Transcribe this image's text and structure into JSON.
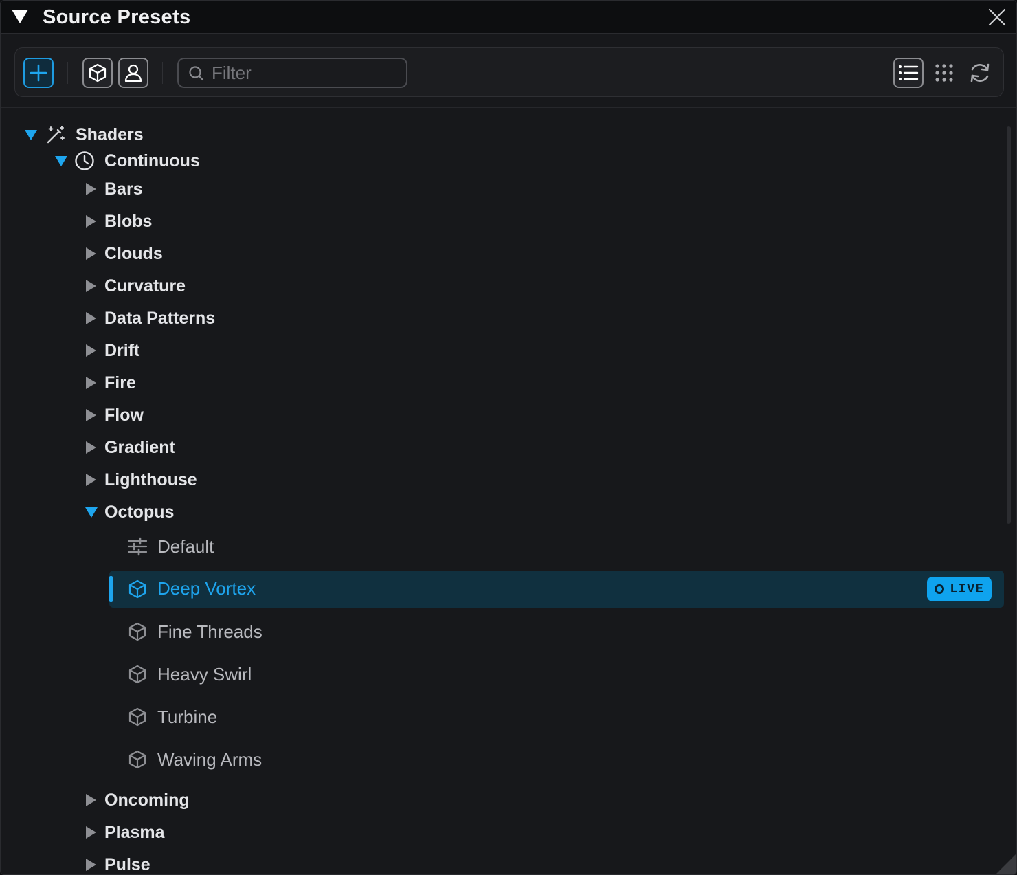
{
  "window": {
    "title": "Source Presets"
  },
  "toolbar": {
    "filter_placeholder": "Filter"
  },
  "tree": {
    "root": {
      "label": "Shaders",
      "icon": "magic-wand-icon",
      "expanded": true
    },
    "group": {
      "label": "Continuous",
      "icon": "clock-icon",
      "expanded": true
    },
    "categories_before": [
      "Bars",
      "Blobs",
      "Clouds",
      "Curvature",
      "Data Patterns",
      "Drift",
      "Fire",
      "Flow",
      "Gradient",
      "Lighthouse"
    ],
    "expanded_category": "Octopus",
    "presets": [
      "Default",
      "Deep Vortex",
      "Fine Threads",
      "Heavy Swirl",
      "Turbine",
      "Waving Arms"
    ],
    "selected_preset": "Deep Vortex",
    "live_badge": "LIVE",
    "categories_after": [
      "Oncoming",
      "Plasma",
      "Pulse"
    ]
  },
  "colors": {
    "accent": "#1ea5ee",
    "selected_bg": "#10303f",
    "panel_bg": "#17181b"
  }
}
